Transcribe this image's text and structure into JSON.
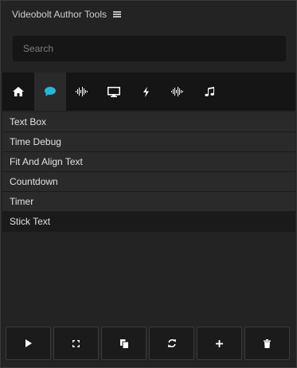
{
  "header": {
    "title": "Videobolt Author Tools",
    "menu_icon": "hamburger-menu-icon"
  },
  "search": {
    "placeholder": "Search",
    "value": ""
  },
  "tabs": [
    {
      "name": "home",
      "icon": "home-icon",
      "active": false
    },
    {
      "name": "text",
      "icon": "chat-bubble-icon",
      "active": true
    },
    {
      "name": "audio",
      "icon": "waveform-icon",
      "active": false
    },
    {
      "name": "display",
      "icon": "monitor-icon",
      "active": false
    },
    {
      "name": "effects",
      "icon": "lightning-bolt-icon",
      "active": false
    },
    {
      "name": "audio-2",
      "icon": "waveform-icon",
      "active": false
    },
    {
      "name": "music",
      "icon": "music-note-icon",
      "active": false
    }
  ],
  "list": {
    "items": [
      {
        "label": "Text Box",
        "selected": false
      },
      {
        "label": "Time Debug",
        "selected": false
      },
      {
        "label": "Fit And Align Text",
        "selected": false
      },
      {
        "label": "Countdown",
        "selected": false
      },
      {
        "label": "Timer",
        "selected": false
      },
      {
        "label": "Stick Text",
        "selected": true
      }
    ]
  },
  "toolbar": {
    "buttons": [
      {
        "name": "play",
        "icon": "play-icon"
      },
      {
        "name": "fullscreen",
        "icon": "expand-icon"
      },
      {
        "name": "copy",
        "icon": "copy-icon"
      },
      {
        "name": "refresh",
        "icon": "refresh-icon"
      },
      {
        "name": "add",
        "icon": "plus-icon"
      },
      {
        "name": "delete",
        "icon": "trash-icon"
      }
    ]
  },
  "colors": {
    "panel_bg": "#232323",
    "tab_bar_bg": "#151515",
    "active_tab_bg": "#2a2a2a",
    "accent": "#29b6d6",
    "list_item_bg": "#2a2a2a",
    "selected_item_bg": "#1a1a1a",
    "icon": "#ffffff"
  }
}
